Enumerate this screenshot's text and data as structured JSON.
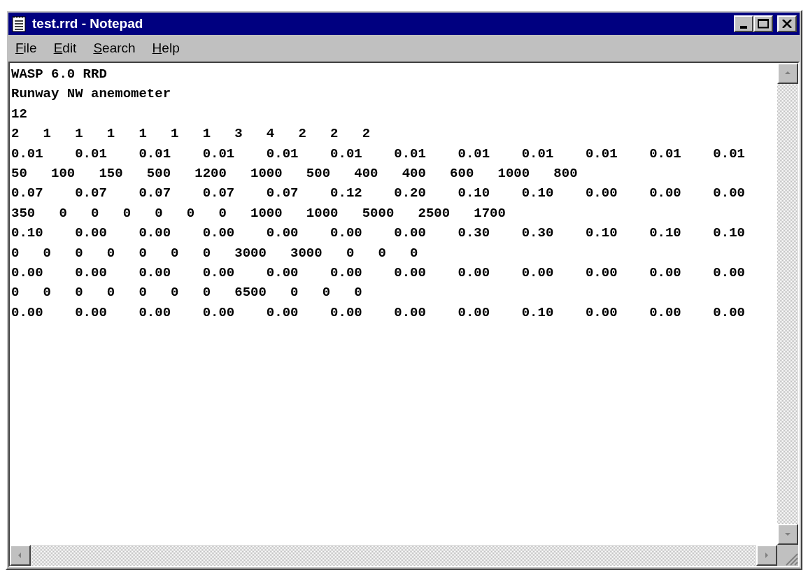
{
  "window": {
    "title": "test.rrd - Notepad"
  },
  "menu": [
    {
      "label": "File"
    },
    {
      "label": "Edit"
    },
    {
      "label": "Search"
    },
    {
      "label": "Help"
    }
  ],
  "lines": [
    "WASP 6.0 RRD",
    "Runway NW anemometer",
    "12",
    "2   1   1   1   1   1   1   3   4   2   2   2",
    "0.01    0.01    0.01    0.01    0.01    0.01    0.01    0.01    0.01    0.01    0.01    0.01",
    "50   100   150   500   1200   1000   500   400   400   600   1000   800",
    "0.07    0.07    0.07    0.07    0.07    0.12    0.20    0.10    0.10    0.00    0.00    0.00",
    "350   0   0   0   0   0   0   1000   1000   5000   2500   1700",
    "0.10    0.00    0.00    0.00    0.00    0.00    0.00    0.30    0.30    0.10    0.10    0.10",
    "0   0   0   0   0   0   0   3000   3000   0   0   0",
    "0.00    0.00    0.00    0.00    0.00    0.00    0.00    0.00    0.00    0.00    0.00    0.00",
    "0   0   0   0   0   0   0   6500   0   0   0",
    "0.00    0.00    0.00    0.00    0.00    0.00    0.00    0.00    0.10    0.00    0.00    0.00"
  ]
}
